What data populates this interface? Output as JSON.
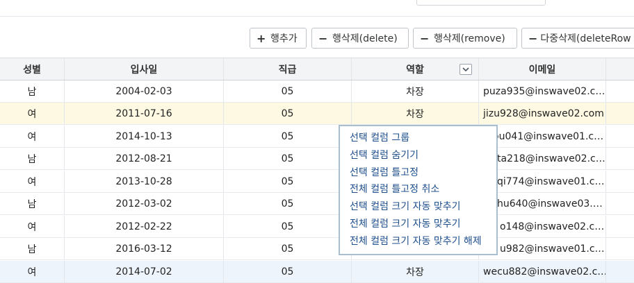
{
  "toolbar": {
    "buttons": [
      {
        "symbol": "+",
        "label": "행추가"
      },
      {
        "symbol": "−",
        "label": "행삭제(delete)"
      },
      {
        "symbol": "−",
        "label": "행삭제(remove)"
      },
      {
        "symbol": "−",
        "label": "다중삭제(deleteRow"
      }
    ]
  },
  "grid": {
    "columns": [
      "성별",
      "입사일",
      "직급",
      "역할",
      "이메일",
      ""
    ],
    "rows": [
      {
        "gender": "남",
        "hire_date": "2004-02-03",
        "grade": "05",
        "role": "차장",
        "email": "puza935@inswave02.c…"
      },
      {
        "gender": "여",
        "hire_date": "2011-07-16",
        "grade": "05",
        "role": "차장",
        "email": "jizu928@inswave02.com"
      },
      {
        "gender": "여",
        "hire_date": "2014-10-13",
        "grade": "05",
        "role": "",
        "email": "ou041@inswave01.c…"
      },
      {
        "gender": "남",
        "hire_date": "2012-08-21",
        "grade": "05",
        "role": "",
        "email": "ta218@inswave02.c…"
      },
      {
        "gender": "여",
        "hire_date": "2013-10-28",
        "grade": "05",
        "role": "",
        "email": "qi774@inswave01.c…"
      },
      {
        "gender": "남",
        "hire_date": "2012-03-02",
        "grade": "05",
        "role": "",
        "email": "hu640@inswave03.…"
      },
      {
        "gender": "여",
        "hire_date": "2012-02-22",
        "grade": "05",
        "role": "",
        "email": "o148@inswave02.c…"
      },
      {
        "gender": "남",
        "hire_date": "2016-03-12",
        "grade": "05",
        "role": "",
        "email": "u982@inswave01.c…"
      },
      {
        "gender": "여",
        "hire_date": "2014-07-02",
        "grade": "05",
        "role": "차장",
        "email": "wecu882@inswave02.c…"
      }
    ]
  },
  "context_menu": {
    "items": [
      "선택 컬럼 그룹",
      "선택 컬럼 숨기기",
      "선택 컬럼 틀고정",
      "전체 컬럼 틀고정 취소",
      "선택 컬럼 크기 자동 맞추기",
      "전체 컬럼 크기 자동 맞추기",
      "전체 컬럼 크기 자동 맞추기 해제"
    ]
  },
  "colors": {
    "header_bg": "#f3f4f6",
    "selected_row_bg": "#fdf9e3",
    "focus_row_bg": "#eef4fb",
    "menu_text": "#1e4f8c",
    "menu_border": "#a9bfcf"
  },
  "icons": {
    "dropdown": "chevron-down-icon"
  }
}
